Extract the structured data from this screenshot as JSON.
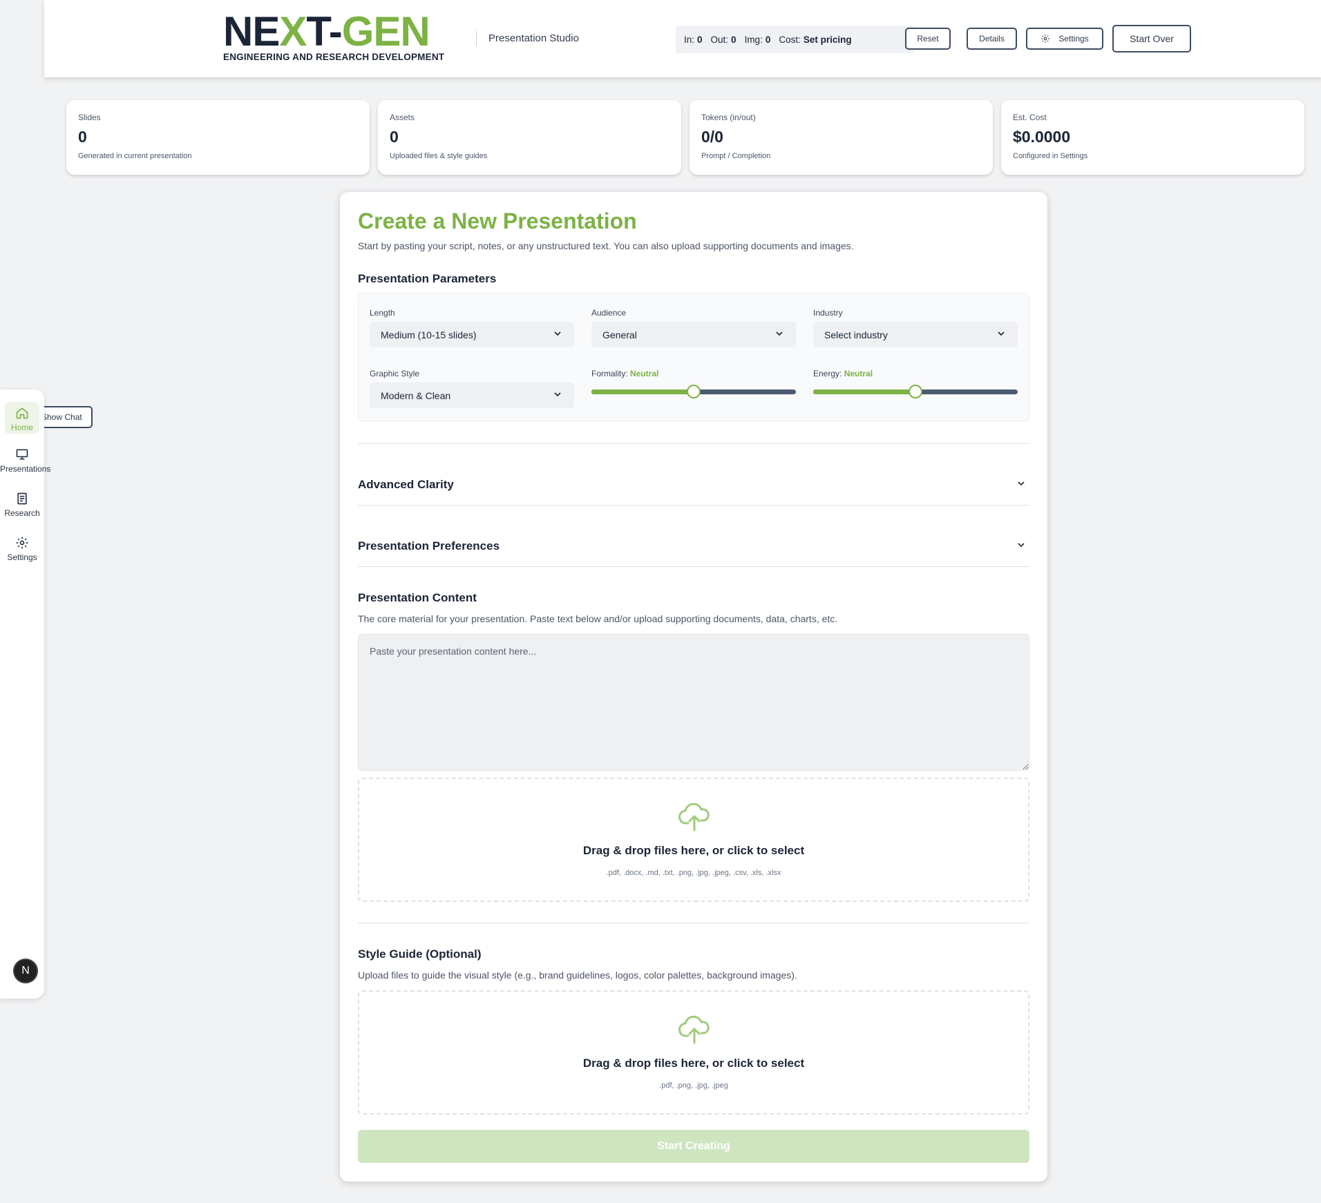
{
  "header": {
    "logo_text_1": "NE",
    "logo_text_2": "X",
    "logo_text_3": "T-",
    "logo_text_4": "GEN",
    "logo_sub": "ENGINEERING AND RESEARCH DEVELOPMENT",
    "app_name": "Presentation Studio",
    "usage": {
      "in_label": "In:",
      "in_value": "0",
      "out_label": "Out:",
      "out_value": "0",
      "img_label": "Img:",
      "img_value": "0",
      "cost_label": "Cost:",
      "cost_value": "Set pricing"
    },
    "reset_label": "Reset",
    "details_label": "Details",
    "settings_label": "Settings",
    "start_over_label": "Start Over"
  },
  "stats": [
    {
      "label": "Slides",
      "value": "0",
      "sub": "Generated in current presentation"
    },
    {
      "label": "Assets",
      "value": "0",
      "sub": "Uploaded files & style guides"
    },
    {
      "label": "Tokens (in/out)",
      "value": "0/0",
      "sub": "Prompt / Completion"
    },
    {
      "label": "Est. Cost",
      "value": "$0.0000",
      "sub": "Configured in Settings"
    }
  ],
  "sidebar": {
    "items": [
      {
        "label": "Home",
        "icon": "home-icon",
        "active": true
      },
      {
        "label": "Presentations",
        "icon": "presentation-icon"
      },
      {
        "label": "Research",
        "icon": "document-icon"
      },
      {
        "label": "Settings",
        "icon": "gear-icon"
      }
    ],
    "avatar_letter": "N",
    "show_chat_label": "Show Chat"
  },
  "main": {
    "title": "Create a New Presentation",
    "subtitle": "Start by pasting your script, notes, or any unstructured text. You can also upload supporting documents and images.",
    "params_heading": "Presentation Parameters",
    "params": {
      "length_label": "Length",
      "length_value": "Medium (10-15 slides)",
      "audience_label": "Audience",
      "audience_value": "General",
      "industry_label": "Industry",
      "industry_value": "Select industry",
      "graphic_style_label": "Graphic Style",
      "graphic_style_value": "Modern & Clean",
      "formality_label": "Formality:",
      "formality_value": "Neutral",
      "formality_level": 0.5,
      "energy_label": "Energy:",
      "energy_value": "Neutral",
      "energy_level": 0.5
    },
    "advanced_clarity_label": "Advanced Clarity",
    "preferences_label": "Presentation Preferences",
    "content_heading": "Presentation Content",
    "content_desc": "The core material for your presentation. Paste text below and/or upload supporting documents, data, charts, etc.",
    "content_placeholder": "Paste your presentation content here...",
    "content_value": "",
    "dropzone_title": "Drag & drop files here, or click to select",
    "dropzone_types": ".pdf, .docx, .md, .txt, .png, .jpg, .jpeg, .csv, .xls, .xlsx",
    "style_heading": "Style Guide (Optional)",
    "style_desc": "Upload files to guide the visual style (e.g., brand guidelines, logos, color palettes, background images).",
    "style_dropzone_title": "Drag & drop files here, or click to select",
    "style_dropzone_types": ".pdf, .png, .jpg, .jpeg",
    "start_label": "Start Creating"
  },
  "colors": {
    "accent": "#7db245",
    "navy": "#1b2537",
    "start_disabled": "#cfe5c0"
  }
}
